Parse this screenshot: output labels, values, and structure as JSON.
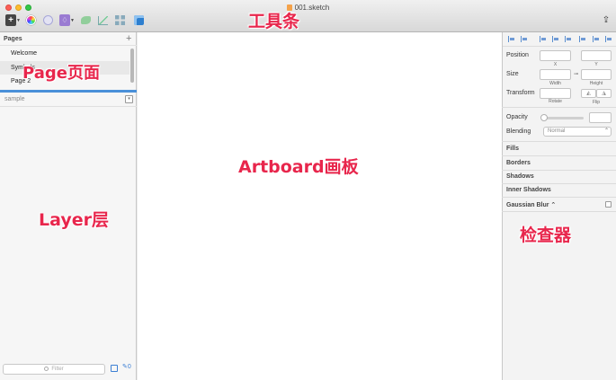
{
  "window": {
    "title": "001.sketch"
  },
  "toolbar": {
    "insert": "+",
    "symbol": "♢"
  },
  "pages": {
    "title": "Pages",
    "add": "+",
    "items": [
      {
        "label": "Welcome"
      },
      {
        "label": "Symbols"
      },
      {
        "label": "Page 2"
      }
    ]
  },
  "layers": {
    "artboard": "sample",
    "filter_placeholder": "Filter",
    "filter_count": "0"
  },
  "inspector": {
    "position_label": "Position",
    "x_label": "X",
    "y_label": "Y",
    "size_label": "Size",
    "width_label": "Width",
    "height_label": "Height",
    "transform_label": "Transform",
    "rotate_label": "Rotate",
    "flip_label": "Flip",
    "opacity_label": "Opacity",
    "blending_label": "Blending",
    "blending_value": "Normal",
    "sections": [
      "Fills",
      "Borders",
      "Shadows",
      "Inner Shadows",
      "Gaussian Blur"
    ]
  },
  "annotations": {
    "toolbar": "工具条",
    "page": "Page页面",
    "artboard": "Artboard画板",
    "layer": "Layer层",
    "inspector": "检查器"
  },
  "colors": {
    "close": "#fc5f57",
    "minimize": "#fdbc2e",
    "maximize": "#33c748",
    "selection_accent": "#4a90d9",
    "annotation": "#e8264c"
  }
}
